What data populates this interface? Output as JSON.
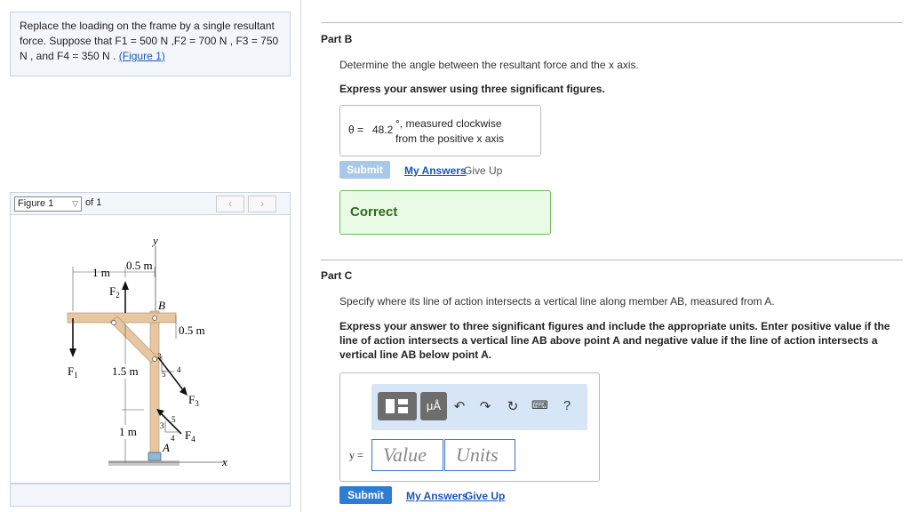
{
  "problem": {
    "intro": "Replace the loading on the frame by a single resultant force. Suppose that ",
    "forces_text": "F1 = 500  N ,F2 = 700  N , F3 = 750  N , and F4 = 350  N .",
    "figure_link": "(Figure 1)"
  },
  "figure_nav": {
    "selected": "Figure 1",
    "of_label": "of 1",
    "prev": "‹",
    "next": "›"
  },
  "figure_labels": {
    "y_axis": "y",
    "x_axis": "x",
    "dim_1m_top": "1 m",
    "dim_05m_top": "0.5 m",
    "dim_05m_right": "0.5 m",
    "dim_15m": "1.5 m",
    "dim_1m_bottom": "1 m",
    "point_b": "B",
    "point_a": "A",
    "f1": "F",
    "f1_sub": "1",
    "f2": "F",
    "f2_sub": "2",
    "f3": "F",
    "f3_sub": "3",
    "f4": "F",
    "f4_sub": "4",
    "tri_f3_3": "3",
    "tri_f3_4": "4",
    "tri_f3_5": "5",
    "tri_f4_3": "3",
    "tri_f4_4": "4",
    "tri_f4_5": "5"
  },
  "part_b": {
    "title": "Part B",
    "prompt": "Determine the angle between the resultant force and the x axis.",
    "instruction": "Express your answer using three significant figures.",
    "var": "θ =",
    "value": "48.2",
    "unit_line1": "°, measured clockwise",
    "unit_line2": "from the positive x axis",
    "submit": "Submit",
    "my_answers": "My Answers",
    "give_up": "Give Up",
    "feedback": "Correct"
  },
  "part_c": {
    "title": "Part C",
    "prompt": "Specify where its line of action intersects a vertical line along member AB, measured from A.",
    "instruction": "Express your answer to three significant figures and include the appropriate units. Enter positive value if the line of action intersects a vertical line AB above point A and negative value if the line of action intersects a vertical line AB below point A.",
    "var": "y =",
    "value_placeholder": "Value",
    "units_placeholder": "Units",
    "submit": "Submit",
    "my_answers": "My Answers",
    "give_up": "Give Up",
    "toolbar": {
      "units_btn": "μÅ",
      "help": "?"
    }
  },
  "colors": {
    "submit_disabled": "#a9c7e6",
    "submit_active": "#2f7dd3",
    "link": "#1a55b5",
    "correct_bg": "#e9fbe4",
    "correct_border": "#6cbd5b",
    "beam": "#e6c7a1"
  }
}
